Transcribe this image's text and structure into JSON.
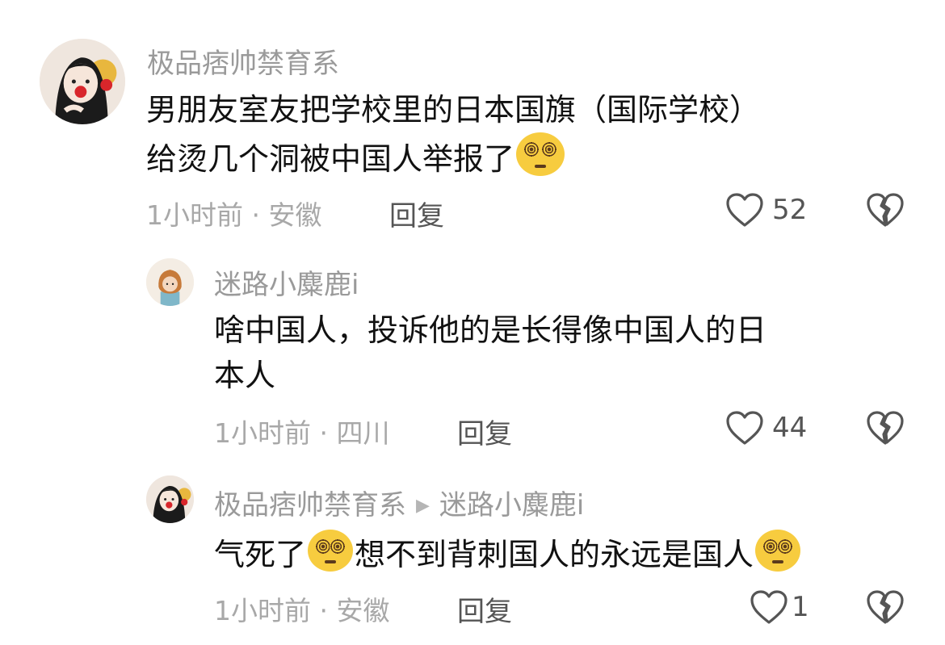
{
  "comments": [
    {
      "username": "极品痞帅禁育系",
      "lines": [
        "男朋友室友把学校里的日本国旗（国际学校）",
        "给烫几个洞被中国人举报了"
      ],
      "emoji": "dizzy-face-emoji",
      "time_location": "1小时前 · 安徽",
      "reply_label": "回复",
      "likes": "52"
    },
    {
      "username": "迷路小麋鹿i",
      "lines": [
        "啥中国人，投诉他的是长得像中国人的日",
        "本人"
      ],
      "time_location": "1小时前 · 四川",
      "reply_label": "回复",
      "likes": "44"
    },
    {
      "username": "极品痞帅禁育系",
      "reply_to": "迷路小麋鹿i",
      "text_a": "气死了",
      "text_b": "想不到背刺国人的永远是国人",
      "emoji": "dizzy-face-emoji",
      "time_location": "1小时前 · 安徽",
      "reply_label": "回复",
      "likes": "1"
    }
  ],
  "colors": {
    "username": "#9a9a9a",
    "text": "#111111",
    "meta": "#a8a8a8",
    "icon": "#555555",
    "emoji_face": "#f7cc3f"
  },
  "icons": {
    "like": "heart-outline-icon",
    "dislike": "broken-heart-icon",
    "reply_arrow": "triangle-right-icon"
  }
}
